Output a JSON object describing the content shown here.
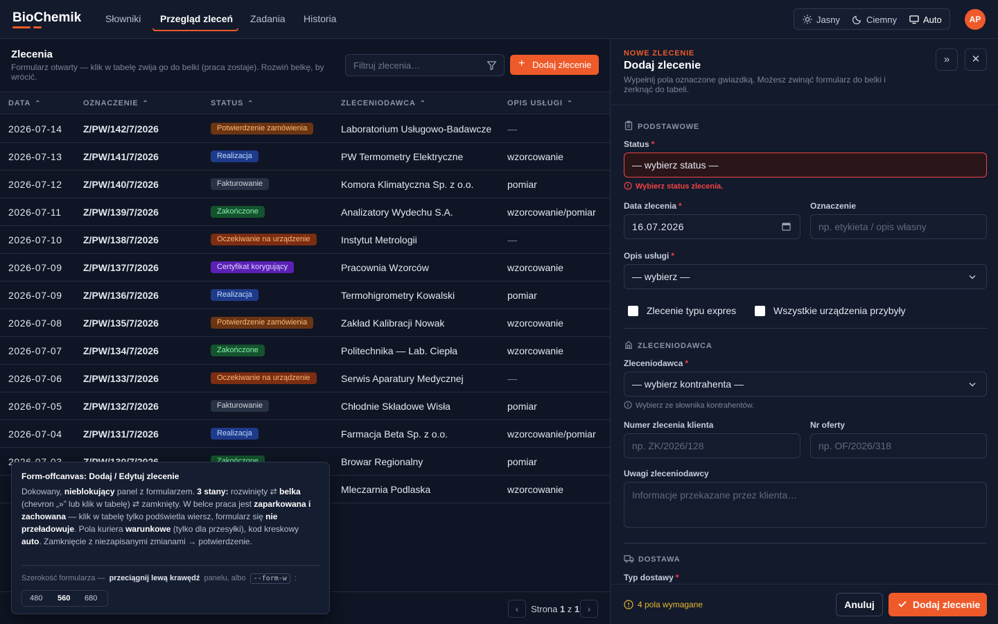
{
  "brand": {
    "name": "BioChemik",
    "accent": "#ef5a2a"
  },
  "nav": {
    "items": [
      "Słowniki",
      "Przegląd zleceń",
      "Zadania",
      "Historia"
    ],
    "active": "Przegląd zleceń"
  },
  "theme": {
    "light": "Jasny",
    "dark": "Ciemny",
    "auto": "Auto"
  },
  "user": {
    "initials": "AP"
  },
  "list": {
    "title": "Zlecenia",
    "subtitle": "Formularz otwarty — klik w tabelę zwija go do belki (praca zostaje). Rozwiń belkę, by wrócić.",
    "filter_placeholder": "Filtruj zlecenia…",
    "add_label": "Dodaj zlecenie",
    "columns": [
      "DATA",
      "OZNACZENIE",
      "STATUS",
      "ZLECENIODAWCA",
      "OPIS USŁUGI"
    ],
    "rows": [
      {
        "date": "2026-07-14",
        "code": "Z/PW/142/7/2026",
        "status": "Potwierdzenie zamówienia",
        "client": "Laboratorium Usługowo-Badawcze",
        "service": "—"
      },
      {
        "date": "2026-07-13",
        "code": "Z/PW/141/7/2026",
        "status": "Realizacja",
        "client": "PW Termometry Elektryczne",
        "service": "wzorcowanie"
      },
      {
        "date": "2026-07-12",
        "code": "Z/PW/140/7/2026",
        "status": "Fakturowanie",
        "client": "Komora Klimatyczna Sp. z o.o.",
        "service": "pomiar"
      },
      {
        "date": "2026-07-11",
        "code": "Z/PW/139/7/2026",
        "status": "Zakończone",
        "client": "Analizatory Wydechu S.A.",
        "service": "wzorcowanie/pomiar"
      },
      {
        "date": "2026-07-10",
        "code": "Z/PW/138/7/2026",
        "status": "Oczekiwanie na urządzenie",
        "client": "Instytut Metrologii",
        "service": "—"
      },
      {
        "date": "2026-07-09",
        "code": "Z/PW/137/7/2026",
        "status": "Certyfikat korygujący",
        "client": "Pracownia Wzorców",
        "service": "wzorcowanie"
      },
      {
        "date": "2026-07-09",
        "code": "Z/PW/136/7/2026",
        "status": "Realizacja",
        "client": "Termohigrometry Kowalski",
        "service": "pomiar"
      },
      {
        "date": "2026-07-08",
        "code": "Z/PW/135/7/2026",
        "status": "Potwierdzenie zamówienia",
        "client": "Zakład Kalibracji Nowak",
        "service": "wzorcowanie"
      },
      {
        "date": "2026-07-07",
        "code": "Z/PW/134/7/2026",
        "status": "Zakończone",
        "client": "Politechnika — Lab. Ciepła",
        "service": "wzorcowanie"
      },
      {
        "date": "2026-07-06",
        "code": "Z/PW/133/7/2026",
        "status": "Oczekiwanie na urządzenie",
        "client": "Serwis Aparatury Medycznej",
        "service": "—"
      },
      {
        "date": "2026-07-05",
        "code": "Z/PW/132/7/2026",
        "status": "Fakturowanie",
        "client": "Chłodnie Składowe Wisła",
        "service": "pomiar"
      },
      {
        "date": "2026-07-04",
        "code": "Z/PW/131/7/2026",
        "status": "Realizacja",
        "client": "Farmacja Beta Sp. z o.o.",
        "service": "wzorcowanie/pomiar"
      },
      {
        "date": "2026-07-03",
        "code": "Z/PW/130/7/2026",
        "status": "Zakończone",
        "client": "Browar Regionalny",
        "service": "pomiar"
      },
      {
        "date": "",
        "code": "",
        "status": "",
        "client": "Mleczarnia Podlaska",
        "service": "wzorcowanie"
      }
    ],
    "status_colors": {
      "Potwierdzenie zamówienia": {
        "bg": "#6b3514",
        "fg": "#fdba74"
      },
      "Realizacja": {
        "bg": "#1e3a8a",
        "fg": "#bfdbfe"
      },
      "Fakturowanie": {
        "bg": "#283244",
        "fg": "#d1d5db"
      },
      "Zakończone": {
        "bg": "#14532d",
        "fg": "#86efac"
      },
      "Oczekiwanie na urządzenie": {
        "bg": "#7c2d12",
        "fg": "#fdba74"
      },
      "Certyfikat korygujący": {
        "bg": "#5b21b6",
        "fg": "#ddd6fe"
      }
    },
    "pager": {
      "prefix": "Strona",
      "current": "1",
      "of": "z",
      "total": "1"
    }
  },
  "tooltip": {
    "title": "Form-offcanvas: Dodaj / Edytuj zlecenie",
    "body_parts": [
      "Dokowany, ",
      "nieblokujący",
      " panel z formularzem. ",
      "3 stany:",
      " rozwinięty ⇄ ",
      "belka",
      " (chevron „»” lub klik w tabelę) ⇄ zamknięty. W belce praca jest ",
      "zaparkowana i zachowana",
      " — klik w tabelę tylko podświetla wiersz, formularz się ",
      "nie przeładowuje",
      ". Pola kuriera ",
      "warunkowe",
      " (tylko dla przesyłki), kod kreskowy ",
      "auto",
      ". Zamknięcie z niezapisanymi zmianami → potwierdzenie."
    ],
    "width_prefix": "Szerokość formularza —",
    "width_action": "przeciągnij lewą krawędź",
    "width_mid": "panelu, albo",
    "width_code": "--form-w",
    "width_suffix": ":",
    "widths": [
      "480",
      "560",
      "680"
    ],
    "active_width": "560"
  },
  "form": {
    "eyebrow": "NOWE ZLECENIE",
    "title": "Dodaj zlecenie",
    "subtitle": "Wypełnij pola oznaczone gwiazdką. Możesz zwinąć formularz do belki i zerknąć do tabeli.",
    "collapse_icon": "»",
    "close_icon": "✕",
    "section_basic": "PODSTAWOWE",
    "status_label": "Status",
    "status_value": "— wybierz status —",
    "status_error": "Wybierz status zlecenia.",
    "date_label": "Data zlecenia",
    "date_value": "16.07.2026",
    "mark_label": "Oznaczenie",
    "mark_placeholder": "np. etykieta / opis własny",
    "service_label": "Opis usługi",
    "service_value": "— wybierz —",
    "express_label": "Zlecenie typu expres",
    "all_devices_label": "Wszystkie urządzenia przybyły",
    "section_client": "ZLECENIODAWCA",
    "client_label": "Zleceniodawca",
    "client_value": "— wybierz kontrahenta —",
    "client_hint": "Wybierz ze słownika kontrahentów.",
    "client_order_label": "Numer zlecenia klienta",
    "client_order_placeholder": "np. ZK/2026/128",
    "offer_label": "Nr oferty",
    "offer_placeholder": "np. OF/2026/318",
    "notes_label": "Uwagi zleceniodawcy",
    "notes_placeholder": "Informacje przekazane przez klienta…",
    "section_delivery": "DOSTAWA",
    "delivery_label": "Typ dostawy",
    "required_count": "4 pola wymagane",
    "cancel": "Anuluj",
    "submit": "Dodaj zlecenie"
  }
}
